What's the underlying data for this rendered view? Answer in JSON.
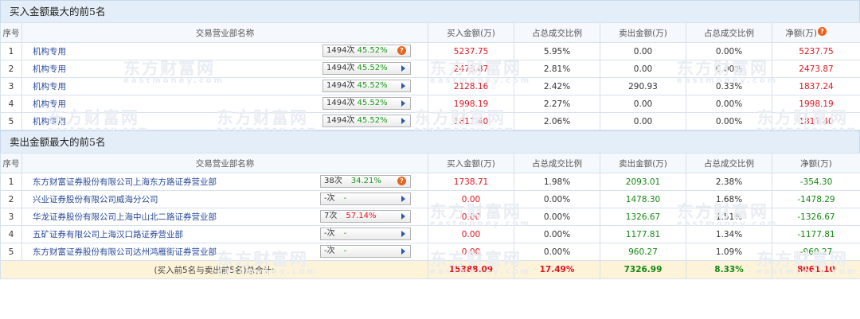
{
  "buy": {
    "title": "买入金额最大的前5名",
    "headers": {
      "idx": "序号",
      "name": "交易营业部名称",
      "buy": "买入金额(万)",
      "buy_ratio": "占总成交比例",
      "sell": "卖出金额(万)",
      "sell_ratio": "占总成交比例",
      "net": "净额(万)"
    },
    "rows": [
      {
        "idx": "1",
        "name": "机构专用",
        "times": "1494次",
        "rate": "45.52%",
        "buy": "5237.75",
        "buy_ratio": "5.95%",
        "sell": "0.00",
        "sell_ratio": "0.00%",
        "net": "5237.75",
        "badge": true
      },
      {
        "idx": "2",
        "name": "机构专用",
        "times": "1494次",
        "rate": "45.52%",
        "buy": "2473.87",
        "buy_ratio": "2.81%",
        "sell": "0.00",
        "sell_ratio": "0.00%",
        "net": "2473.87",
        "badge": false
      },
      {
        "idx": "3",
        "name": "机构专用",
        "times": "1494次",
        "rate": "45.52%",
        "buy": "2128.16",
        "buy_ratio": "2.42%",
        "sell": "290.93",
        "sell_ratio": "0.33%",
        "net": "1837.24",
        "badge": false
      },
      {
        "idx": "4",
        "name": "机构专用",
        "times": "1494次",
        "rate": "45.52%",
        "buy": "1998.19",
        "buy_ratio": "2.27%",
        "sell": "0.00",
        "sell_ratio": "0.00%",
        "net": "1998.19",
        "badge": false
      },
      {
        "idx": "5",
        "name": "机构专用",
        "times": "1494次",
        "rate": "45.52%",
        "buy": "1811.40",
        "buy_ratio": "2.06%",
        "sell": "0.00",
        "sell_ratio": "0.00%",
        "net": "1811.40",
        "badge": false
      }
    ]
  },
  "sell": {
    "title": "卖出金额最大的前5名",
    "headers": {
      "idx": "序号",
      "name": "交易营业部名称",
      "buy": "买入金额(万)",
      "buy_ratio": "占总成交比例",
      "sell": "卖出金额(万)",
      "sell_ratio": "占总成交比例",
      "net": "净额(万)"
    },
    "rows": [
      {
        "idx": "1",
        "name": "东方财富证券股份有限公司上海东方路证券营业部",
        "times": "38次",
        "rate": "34.21%",
        "rate_color": "green",
        "buy": "1738.71",
        "buy_ratio": "1.98%",
        "sell": "2093.01",
        "sell_ratio": "2.38%",
        "net": "-354.30",
        "badge": true
      },
      {
        "idx": "2",
        "name": "兴业证券股份有限公司威海分公司",
        "times": "-次",
        "rate": "-",
        "rate_color": "green",
        "buy": "0.00",
        "buy_ratio": "0.00%",
        "sell": "1478.30",
        "sell_ratio": "1.68%",
        "net": "-1478.29",
        "badge": false
      },
      {
        "idx": "3",
        "name": "华龙证券股份有限公司上海中山北二路证券营业部",
        "times": "7次",
        "rate": "57.14%",
        "rate_color": "red",
        "buy": "0.00",
        "buy_ratio": "0.00%",
        "sell": "1326.67",
        "sell_ratio": "1.51%",
        "net": "-1326.67",
        "badge": false
      },
      {
        "idx": "4",
        "name": "五矿证券有限公司上海汉口路证券营业部",
        "times": "-次",
        "rate": "-",
        "rate_color": "green",
        "buy": "0.00",
        "buy_ratio": "0.00%",
        "sell": "1177.81",
        "sell_ratio": "1.34%",
        "net": "-1177.81",
        "badge": false
      },
      {
        "idx": "5",
        "name": "东方财富证券股份有限公司达州鸿雁街证券营业部",
        "times": "-次",
        "rate": "-",
        "rate_color": "green",
        "buy": "0.00",
        "buy_ratio": "0.00%",
        "sell": "960.27",
        "sell_ratio": "1.09%",
        "net": "-960.27",
        "badge": false
      }
    ],
    "total": {
      "label": "(买入前5名与卖出前5名)总合计:",
      "buy": "15388.09",
      "buy_ratio": "17.49%",
      "sell": "7326.99",
      "sell_ratio": "8.33%",
      "net": "8061.10"
    }
  },
  "badge_text": "?",
  "watermark": {
    "cn": "东方财富网",
    "en": "eastmoney.com"
  },
  "colors": {
    "up": "#e0141e",
    "down": "#118811",
    "link": "#2a4b9b",
    "header_bg": "#e4eef8",
    "total_bg": "#fdf3d8"
  }
}
